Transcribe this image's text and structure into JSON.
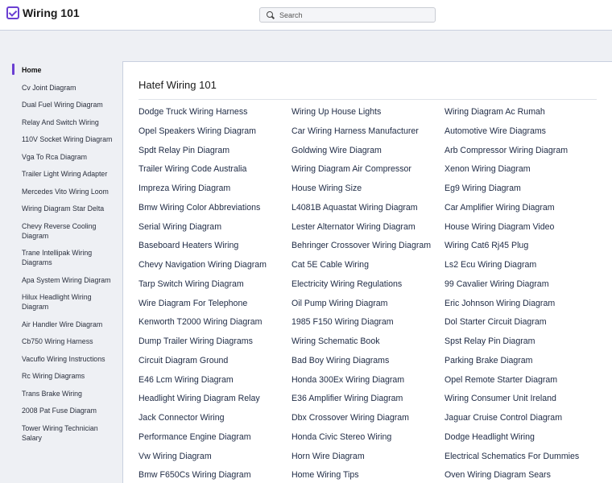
{
  "header": {
    "site_title": "Wiring 101",
    "search_placeholder": "Search",
    "logo_icon": "checkbox-icon",
    "accent_color": "#6a3fd2"
  },
  "sidebar": {
    "items": [
      {
        "label": "Home",
        "active": true
      },
      {
        "label": "Cv Joint Diagram"
      },
      {
        "label": "Dual Fuel Wiring Diagram"
      },
      {
        "label": "Relay And Switch Wiring"
      },
      {
        "label": "110V Socket Wiring Diagram"
      },
      {
        "label": "Vga To Rca Diagram"
      },
      {
        "label": "Trailer Light Wiring Adapter"
      },
      {
        "label": "Mercedes Vito Wiring Loom"
      },
      {
        "label": "Wiring Diagram Star Delta"
      },
      {
        "label": "Chevy Reverse Cooling Diagram"
      },
      {
        "label": "Trane Intellipak Wiring Diagrams"
      },
      {
        "label": "Apa System Wiring Diagram"
      },
      {
        "label": "Hilux Headlight Wiring Diagram"
      },
      {
        "label": "Air Handler Wire Diagram"
      },
      {
        "label": "Cb750 Wiring Harness"
      },
      {
        "label": "Vacuflo Wiring Instructions"
      },
      {
        "label": "Rc Wiring Diagrams"
      },
      {
        "label": "Trans Brake Wiring"
      },
      {
        "label": "2008 Pat Fuse Diagram"
      },
      {
        "label": "Tower Wiring Technician Salary"
      }
    ]
  },
  "main": {
    "title": "Hatef Wiring 101",
    "links": [
      "Dodge Truck Wiring Harness",
      "Wiring Up House Lights",
      "Wiring Diagram Ac Rumah",
      "Opel Speakers Wiring Diagram",
      "Car Wiring Harness Manufacturer",
      "Automotive Wire Diagrams",
      "Spdt Relay Pin Diagram",
      "Goldwing Wire Diagram",
      "Arb Compressor Wiring Diagram",
      "Trailer Wiring Code Australia",
      "Wiring Diagram Air Compressor",
      "Xenon Wiring Diagram",
      "Impreza Wiring Diagram",
      "House Wiring Size",
      "Eg9 Wiring Diagram",
      "Bmw Wiring Color Abbreviations",
      "L4081B Aquastat Wiring Diagram",
      "Car Amplifier Wiring Diagram",
      "Serial Wiring Diagram",
      "Lester Alternator Wiring Diagram",
      "House Wiring Diagram Video",
      "Baseboard Heaters Wiring",
      "Behringer Crossover Wiring Diagram",
      "Wiring Cat6 Rj45 Plug",
      "Chevy Navigation Wiring Diagram",
      "Cat 5E Cable Wiring",
      "Ls2 Ecu Wiring Diagram",
      "Tarp Switch Wiring Diagram",
      "Electricity Wiring Regulations",
      "99 Cavalier Wiring Diagram",
      "Wire Diagram For Telephone",
      "Oil Pump Wiring Diagram",
      "Eric Johnson Wiring Diagram",
      "Kenworth T2000 Wiring Diagram",
      "1985 F150 Wiring Diagram",
      "Dol Starter Circuit Diagram",
      "Dump Trailer Wiring Diagrams",
      "Wiring Schematic Book",
      "Spst Relay Pin Diagram",
      "Circuit Diagram Ground",
      "Bad Boy Wiring Diagrams",
      "Parking Brake Diagram",
      "E46 Lcm Wiring Diagram",
      "Honda 300Ex Wiring Diagram",
      "Opel Remote Starter Diagram",
      "Headlight Wiring Diagram Relay",
      "E36 Amplifier Wiring Diagram",
      "Wiring Consumer Unit Ireland",
      "Jack Connector Wiring",
      "Dbx Crossover Wiring Diagram",
      "Jaguar Cruise Control Diagram",
      "Performance Engine Diagram",
      "Honda Civic Stereo Wiring",
      "Dodge Headlight Wiring",
      "Vw Wiring Diagram",
      "Horn Wire Diagram",
      "Electrical Schematics For Dummies",
      "Bmw F650Cs Wiring Diagram",
      "Home Wiring Tips",
      "Oven Wiring Diagram Sears"
    ]
  }
}
